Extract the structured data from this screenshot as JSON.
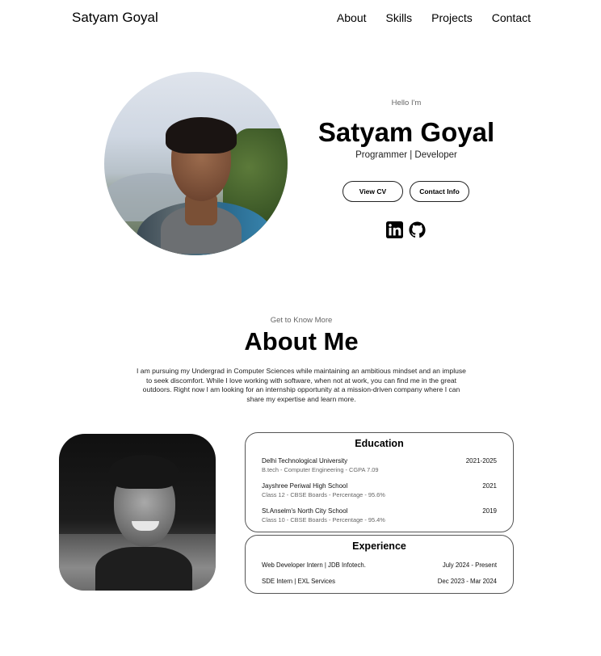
{
  "nav": {
    "logo": "Satyam Goyal",
    "links": [
      "About",
      "Skills",
      "Projects",
      "Contact"
    ]
  },
  "hero": {
    "greeting": "Hello I'm",
    "name": "Satyam Goyal",
    "role": "Programmer | Developer",
    "buttons": {
      "cv": "View CV",
      "contact": "Contact Info"
    },
    "social_icons": [
      "linkedin-icon",
      "github-icon"
    ]
  },
  "about": {
    "kicker": "Get to Know More",
    "title": "About Me",
    "text": "I am pursuing my Undergrad in Computer Sciences while maintaining an ambitious mindset and an impluse to seek discomfort. While I love working with software, when not at work, you can find me in the great outdoors. Right now I am looking for an internship opportunity at a mission-driven company where I can share my expertise and learn more."
  },
  "education": {
    "title": "Education",
    "items": [
      {
        "school": "Delhi Technological University",
        "years": "2021-2025",
        "detail": "B.tech - Computer Engineering - CGPA 7.09"
      },
      {
        "school": "Jayshree Periwal High School",
        "years": "2021",
        "detail": "Class 12 - CBSE Boards - Percentage - 95.6%"
      },
      {
        "school": "St.Anselm's North City School",
        "years": "2019",
        "detail": "Class 10 - CBSE Boards - Percentage - 95.4%"
      }
    ]
  },
  "experience": {
    "title": "Experience",
    "items": [
      {
        "role": "Web Developer Intern | JDB Infotech.",
        "period": "July 2024 - Present"
      },
      {
        "role": "SDE Intern | EXL Services",
        "period": "Dec 2023 - Mar 2024"
      }
    ]
  }
}
